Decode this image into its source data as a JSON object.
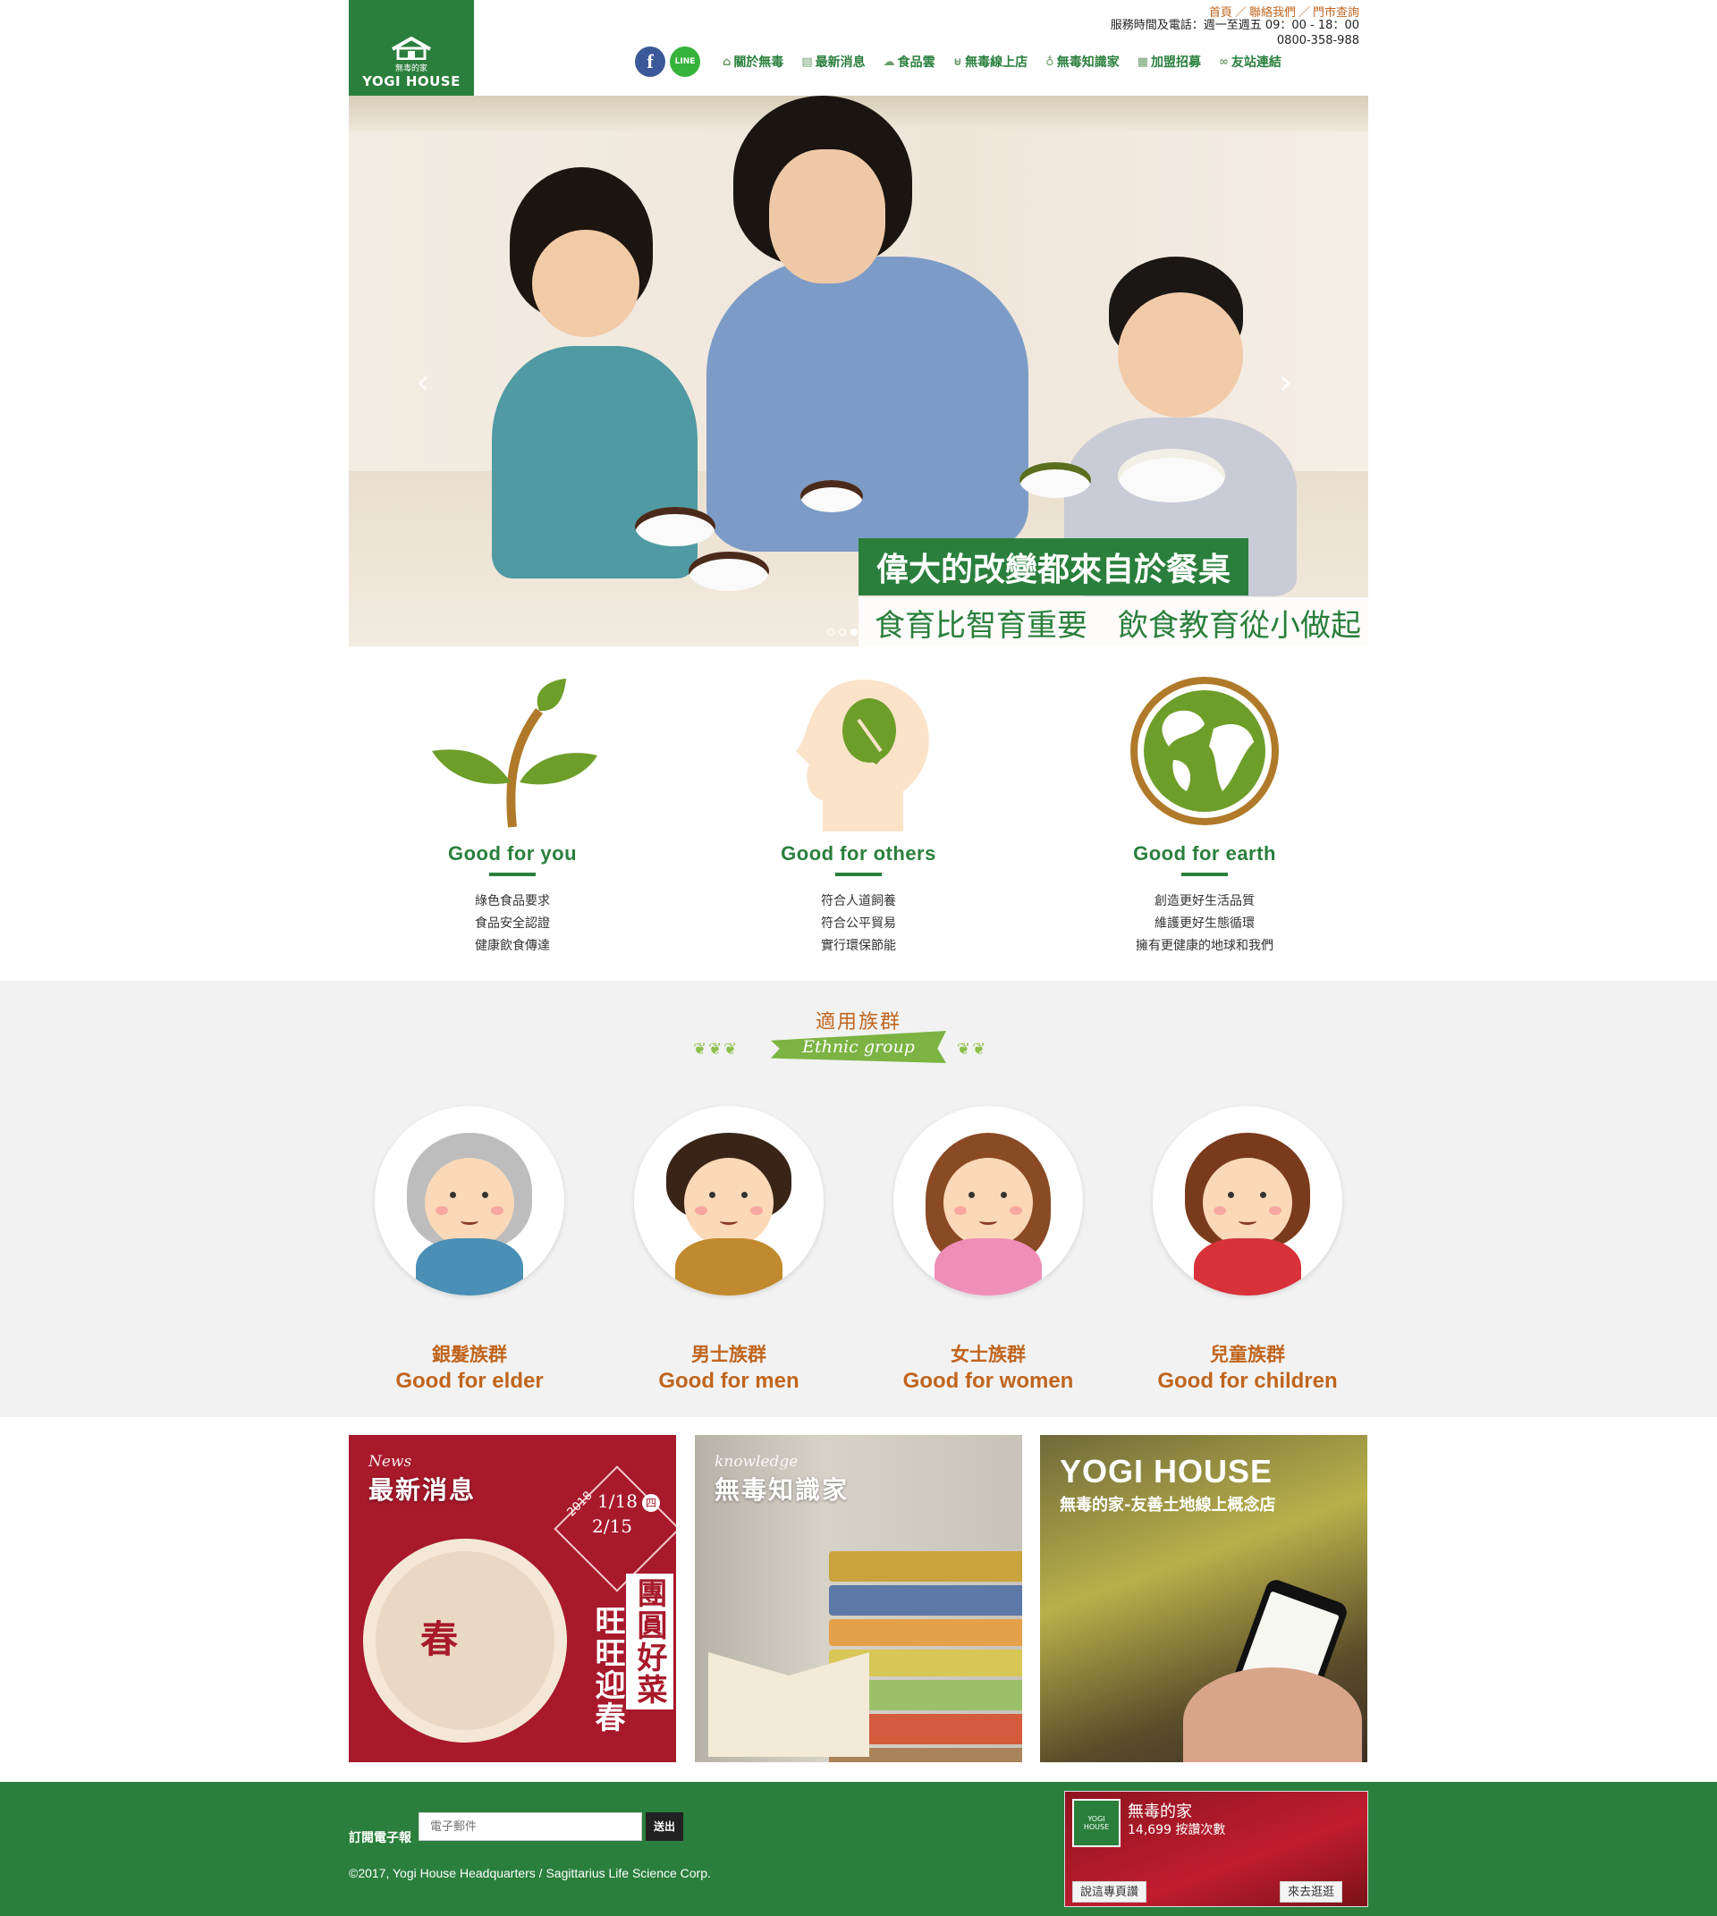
{
  "header": {
    "logo_zh": "無毒的家",
    "logo_en": "YOGI HOUSE",
    "top_links": [
      "首頁",
      "聯絡我們",
      "門市查詢"
    ],
    "hours": "服務時間及電話：週一至週五 09：00 - 18：00",
    "phone": "0800-358-988",
    "social": {
      "facebook": "f",
      "line": "LINE"
    },
    "nav": [
      {
        "label": "關於無毒",
        "icon": "house-icon"
      },
      {
        "label": "最新消息",
        "icon": "document-icon"
      },
      {
        "label": "食品雲",
        "icon": "cloud-icon"
      },
      {
        "label": "無毒線上店",
        "icon": "basket-icon"
      },
      {
        "label": "無毒知識家",
        "icon": "lightbulb-icon"
      },
      {
        "label": "加盟招募",
        "icon": "storefront-icon"
      },
      {
        "label": "友站連結",
        "icon": "link-icon"
      }
    ]
  },
  "hero": {
    "headline": "偉大的改變都來自於餐桌",
    "subline": "食育比智育重要　飲食教育從小做起",
    "prev_icon": "‹",
    "next_icon": "›",
    "slides": 3,
    "active_slide": 3
  },
  "values": [
    {
      "title": "Good for you",
      "lines": [
        "綠色食品要求",
        "食品安全認證",
        "健康飲食傳達"
      ]
    },
    {
      "title": "Good for others",
      "lines": [
        "符合人道飼養",
        "符合公平貿易",
        "實行環保節能"
      ]
    },
    {
      "title": "Good for earth",
      "lines": [
        "創造更好生活品質",
        "維護更好生態循環",
        "擁有更健康的地球和我們"
      ]
    }
  ],
  "ethnic": {
    "title": "適用族群",
    "banner": "Ethnic group",
    "groups": [
      {
        "zh": "銀髮族群",
        "en": "Good for elder"
      },
      {
        "zh": "男士族群",
        "en": "Good for men"
      },
      {
        "zh": "女士族群",
        "en": "Good for women"
      },
      {
        "zh": "兒童族群",
        "en": "Good for children"
      }
    ]
  },
  "cards": {
    "news": {
      "small": "News",
      "title": "最新消息",
      "date1": "2018",
      "date2": "1/18",
      "date3": "2/15",
      "badge1": "四",
      "promo1": "團圓好菜",
      "promo2": "旺旺迎春",
      "center": "春"
    },
    "knowledge": {
      "small": "knowledge",
      "title": "無毒知識家"
    },
    "shop": {
      "title": "YOGI HOUSE",
      "subtitle": "無毒的家-友善土地線上概念店"
    }
  },
  "footer": {
    "subscribe_label": "訂閱電子報",
    "email_placeholder": "電子郵件",
    "submit_label": "送出",
    "copyright": "©2017, Yogi House Headquarters / Sagittarius Life Science Corp.",
    "fb_page_name": "無毒的家",
    "fb_likes": "14,699 按讚次數",
    "fb_like_btn": "說這專頁讚",
    "fb_visit_btn": "來去逛逛"
  },
  "colors": {
    "brand_green": "#2a7f3c",
    "accent_orange": "#c0651e",
    "news_red": "#a7192b"
  }
}
